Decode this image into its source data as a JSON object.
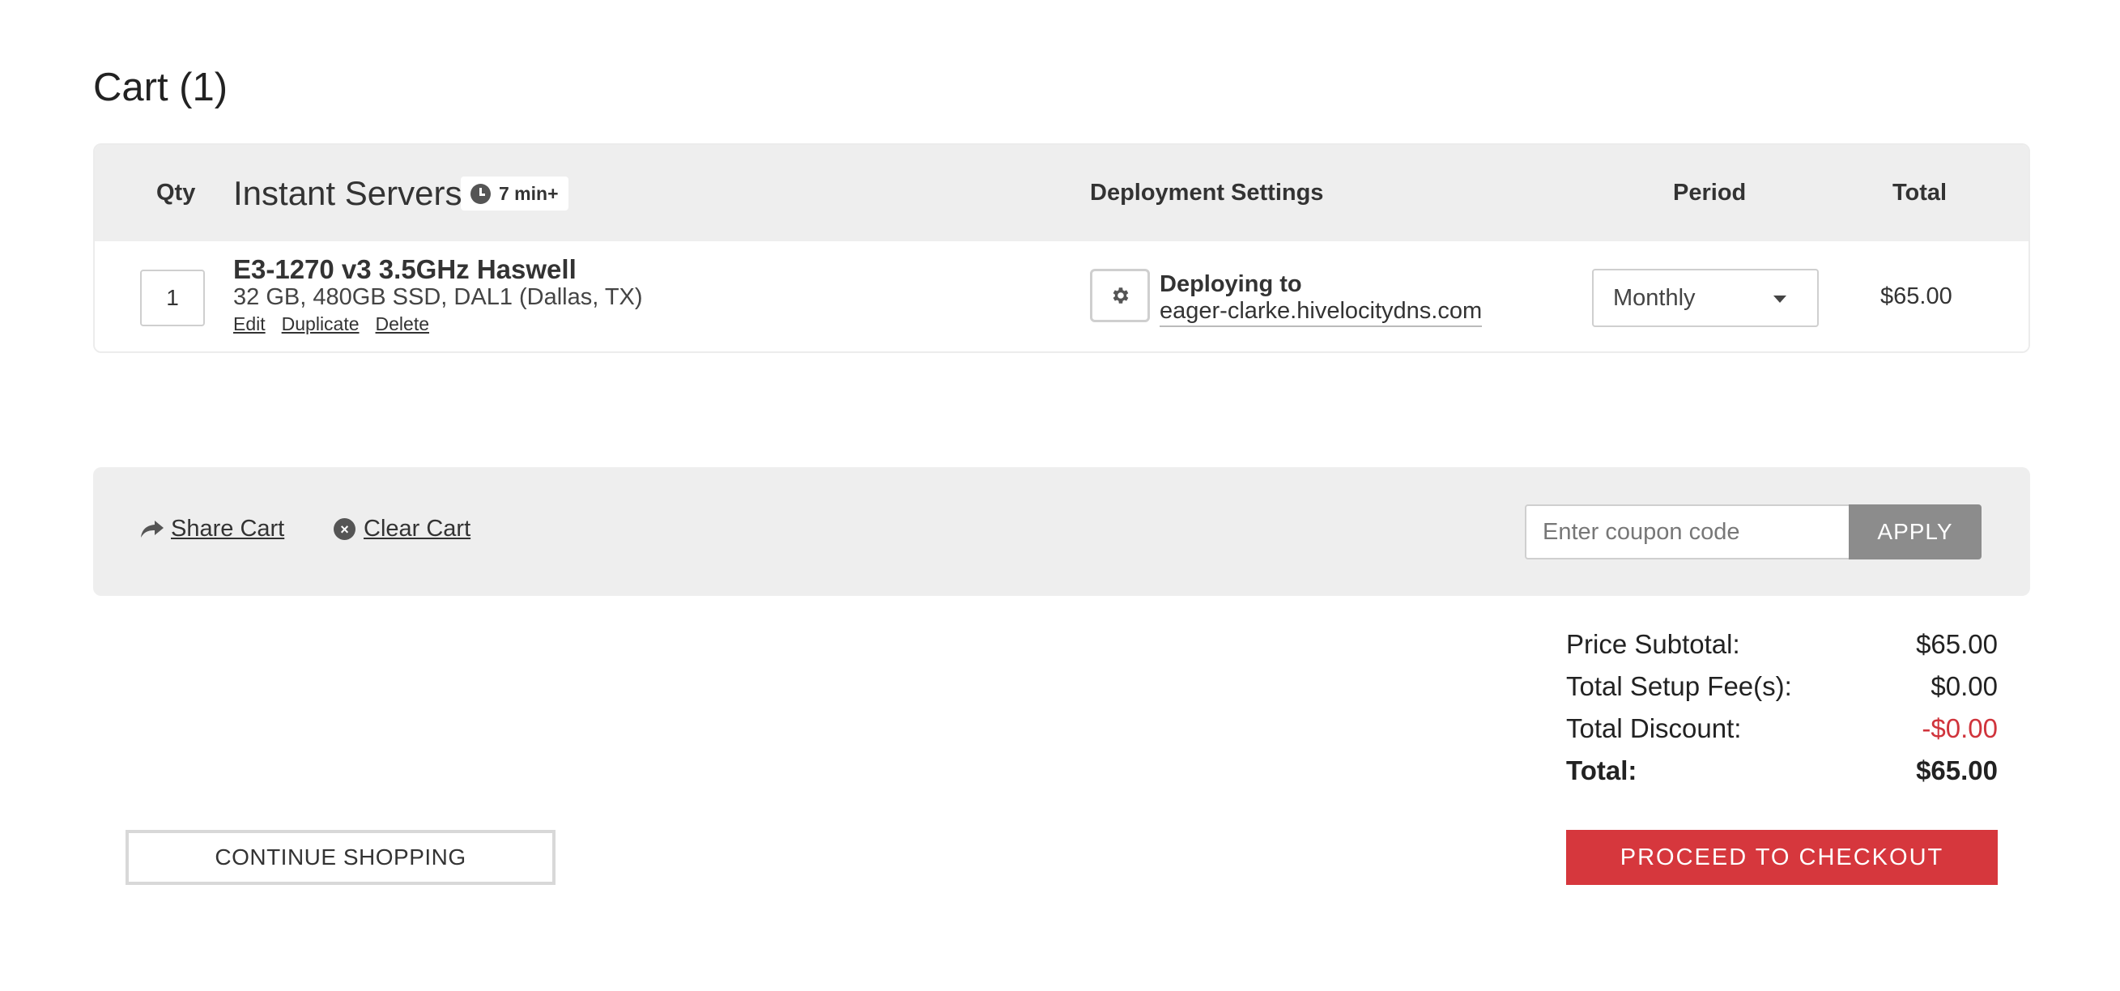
{
  "page": {
    "title": "Cart (1)"
  },
  "cart_table": {
    "headers": {
      "qty": "Qty",
      "product": "Instant Servers",
      "badge": "7 min+",
      "deployment": "Deployment Settings",
      "period": "Period",
      "total": "Total"
    },
    "items": [
      {
        "qty": "1",
        "name": "E3-1270 v3 3.5GHz Haswell",
        "spec": "32 GB, 480GB SSD, DAL1 (Dallas, TX)",
        "links": {
          "edit": "Edit",
          "duplicate": "Duplicate",
          "delete": "Delete"
        },
        "deploy_title": "Deploying to",
        "deploy_host": "eager-clarke.hivelocitydns.com",
        "period": "Monthly",
        "total": "$65.00"
      }
    ]
  },
  "actions": {
    "share": "Share Cart",
    "clear": "Clear Cart",
    "coupon_placeholder": "Enter coupon code",
    "apply": "APPLY"
  },
  "summary": {
    "subtotal_label": "Price Subtotal:",
    "subtotal_value": "$65.00",
    "setup_label": "Total Setup Fee(s):",
    "setup_value": "$0.00",
    "discount_label": "Total Discount:",
    "discount_value": "-$0.00",
    "total_label": "Total:",
    "total_value": "$65.00"
  },
  "buttons": {
    "continue": "CONTINUE SHOPPING",
    "checkout": "PROCEED TO CHECKOUT"
  },
  "colors": {
    "accent": "#d6373d",
    "header_bg": "#eeeeee",
    "apply_bg": "#8c8c8c"
  },
  "icons": [
    "clock-icon",
    "gear-icon",
    "share-arrow-icon",
    "close-circle-icon",
    "chevron-down-icon"
  ]
}
